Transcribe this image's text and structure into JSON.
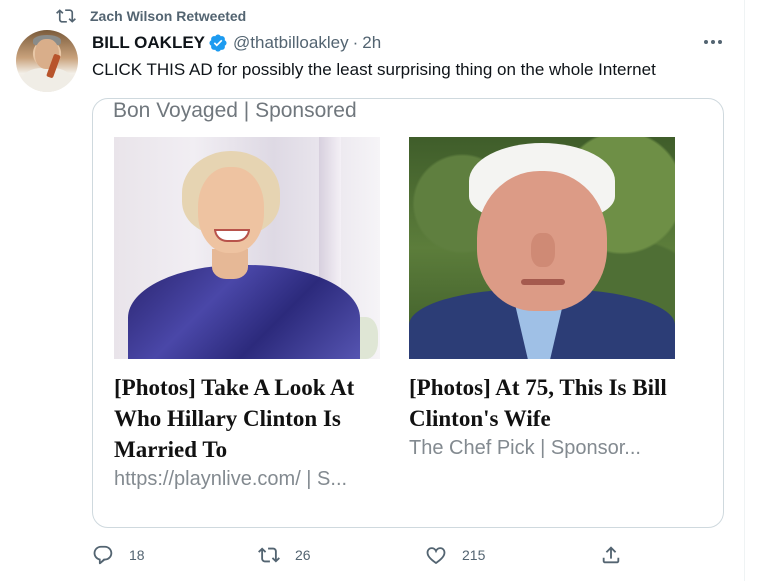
{
  "retweet_context": {
    "text": "Zach Wilson Retweeted",
    "icon": "retweet-icon"
  },
  "tweet": {
    "author_name": "BILL OAKLEY",
    "verified": true,
    "handle": "@thatbilloakley",
    "separator": "·",
    "time": "2h",
    "text": "CLICK THIS AD for possibly the least surprising thing on the whole Internet"
  },
  "card": {
    "header": "Bon Voyaged | Sponsored",
    "ads": [
      {
        "title": "[Photos] Take A Look At Who Hillary Clinton Is Married To",
        "source": "https://playnlive.com/ | S..."
      },
      {
        "title": "[Photos] At 75, This Is Bill Clinton's Wife",
        "source": "The Chef Pick | Sponsor..."
      }
    ]
  },
  "actions": {
    "reply": {
      "icon": "reply-icon",
      "count": "18"
    },
    "retweet": {
      "icon": "retweet-icon",
      "count": "26"
    },
    "like": {
      "icon": "heart-icon",
      "count": "215"
    },
    "share": {
      "icon": "share-icon"
    }
  },
  "colors": {
    "text": "#0f1419",
    "secondary": "#536471",
    "verified": "#1d9bf0",
    "border": "#cfd9de"
  }
}
